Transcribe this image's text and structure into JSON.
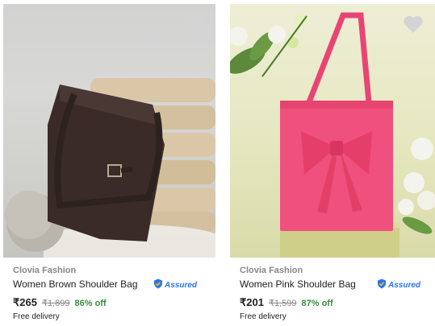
{
  "products": [
    {
      "brand": "Clovia Fashion",
      "title": "Women Brown Shoulder Bag",
      "assured_label": "Assured",
      "price": "₹265",
      "mrp": "₹1,899",
      "discount": "86% off",
      "delivery": "Free delivery",
      "bag_color": "#3a2b28"
    },
    {
      "brand": "Clovia Fashion",
      "title": "Women Pink Shoulder Bag",
      "assured_label": "Assured",
      "price": "₹201",
      "mrp": "₹1,599",
      "discount": "87% off",
      "delivery": "Free delivery",
      "bag_color": "#f0507e"
    }
  ],
  "icons": {
    "wishlist": "heart-icon",
    "assured": "shield-check-icon"
  }
}
